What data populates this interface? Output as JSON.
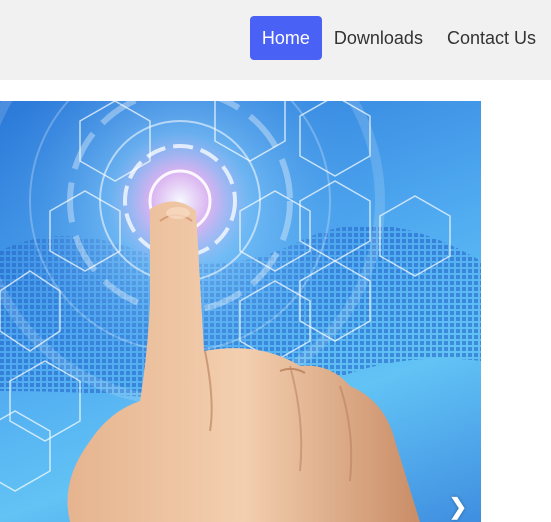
{
  "nav": {
    "items": [
      {
        "label": "Home",
        "active": true
      },
      {
        "label": "Downloads",
        "active": false
      },
      {
        "label": "Contact Us",
        "active": false
      }
    ]
  },
  "slider": {
    "next_glyph": "❯",
    "image_subject": "finger-touching-holographic-interface"
  },
  "colors": {
    "navbar_bg": "#f1f1f1",
    "active_bg": "#4a61f5",
    "active_text": "#ffffff",
    "link_text": "#333333"
  }
}
